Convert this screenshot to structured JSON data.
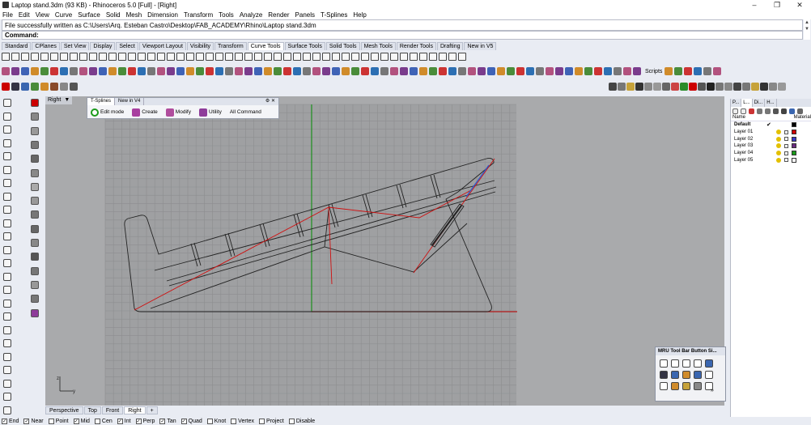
{
  "window": {
    "title": "Laptop stand.3dm (93 KB) - Rhinoceros 5.0 [Full] - [Right]",
    "controls": [
      "–",
      "❐",
      "✕"
    ]
  },
  "menu": [
    "File",
    "Edit",
    "View",
    "Curve",
    "Surface",
    "Solid",
    "Mesh",
    "Dimension",
    "Transform",
    "Tools",
    "Analyze",
    "Render",
    "Panels",
    "T-Splines",
    "Help"
  ],
  "command": {
    "history": "File successfully written as C:\\Users\\Arq. Esteban Castro\\Desktop\\FAB_ACADEMY\\Rhino\\Laptop stand.3dm",
    "prompt": "Command:"
  },
  "toolbar_tabs": [
    {
      "label": "Standard",
      "active": false
    },
    {
      "label": "CPlanes",
      "active": false
    },
    {
      "label": "Set View",
      "active": false
    },
    {
      "label": "Display",
      "active": false
    },
    {
      "label": "Select",
      "active": false
    },
    {
      "label": "Viewport Layout",
      "active": false
    },
    {
      "label": "Visibility",
      "active": false
    },
    {
      "label": "Transform",
      "active": false
    },
    {
      "label": "Curve Tools",
      "active": true
    },
    {
      "label": "Surface Tools",
      "active": false
    },
    {
      "label": "Solid Tools",
      "active": false
    },
    {
      "label": "Mesh Tools",
      "active": false
    },
    {
      "label": "Render Tools",
      "active": false
    },
    {
      "label": "Drafting",
      "active": false
    },
    {
      "label": "New in V5",
      "active": false
    }
  ],
  "scripts_label": "Scripts",
  "viewport": {
    "name": "Right",
    "menu_arrow": "▼",
    "axis_x": "y",
    "axis_y": "z"
  },
  "tsplines_panel": {
    "tabs": [
      "T-Splines",
      "New in V4"
    ],
    "items": [
      "Edit mode",
      "Create",
      "Modify",
      "Utility",
      "All Command"
    ]
  },
  "viewport_tabs": [
    {
      "label": "Perspective",
      "active": false
    },
    {
      "label": "Top",
      "active": false
    },
    {
      "label": "Front",
      "active": false
    },
    {
      "label": "Right",
      "active": true
    },
    {
      "label": "+",
      "active": false
    }
  ],
  "osnaps": [
    {
      "label": "End",
      "checked": true
    },
    {
      "label": "Near",
      "checked": true
    },
    {
      "label": "Point",
      "checked": false
    },
    {
      "label": "Mid",
      "checked": true
    },
    {
      "label": "Cen",
      "checked": false
    },
    {
      "label": "Int",
      "checked": true
    },
    {
      "label": "Perp",
      "checked": true
    },
    {
      "label": "Tan",
      "checked": true
    },
    {
      "label": "Quad",
      "checked": true
    },
    {
      "label": "Knot",
      "checked": false
    },
    {
      "label": "Vertex",
      "checked": false
    },
    {
      "label": "Project",
      "checked": false
    },
    {
      "label": "Disable",
      "checked": false
    }
  ],
  "layers_panel": {
    "tabs": [
      "P...",
      "L...",
      "Di...",
      "H..."
    ],
    "col_name": "Name",
    "col_material": "Material",
    "layers": [
      {
        "name": "Default",
        "current": true,
        "color": "#000000"
      },
      {
        "name": "Layer 01",
        "current": false,
        "color": "#d00000"
      },
      {
        "name": "Layer 02",
        "current": false,
        "color": "#3a3ac8"
      },
      {
        "name": "Layer 03",
        "current": false,
        "color": "#6a2a80"
      },
      {
        "name": "Layer 04",
        "current": false,
        "color": "#1a9a1a"
      },
      {
        "name": "Layer 05",
        "current": false,
        "color": "#ffffff"
      }
    ],
    "current_mark": "✔"
  },
  "mru_toolbar": {
    "title": "MRU Tool Bar Button Si...",
    "more": "»"
  }
}
